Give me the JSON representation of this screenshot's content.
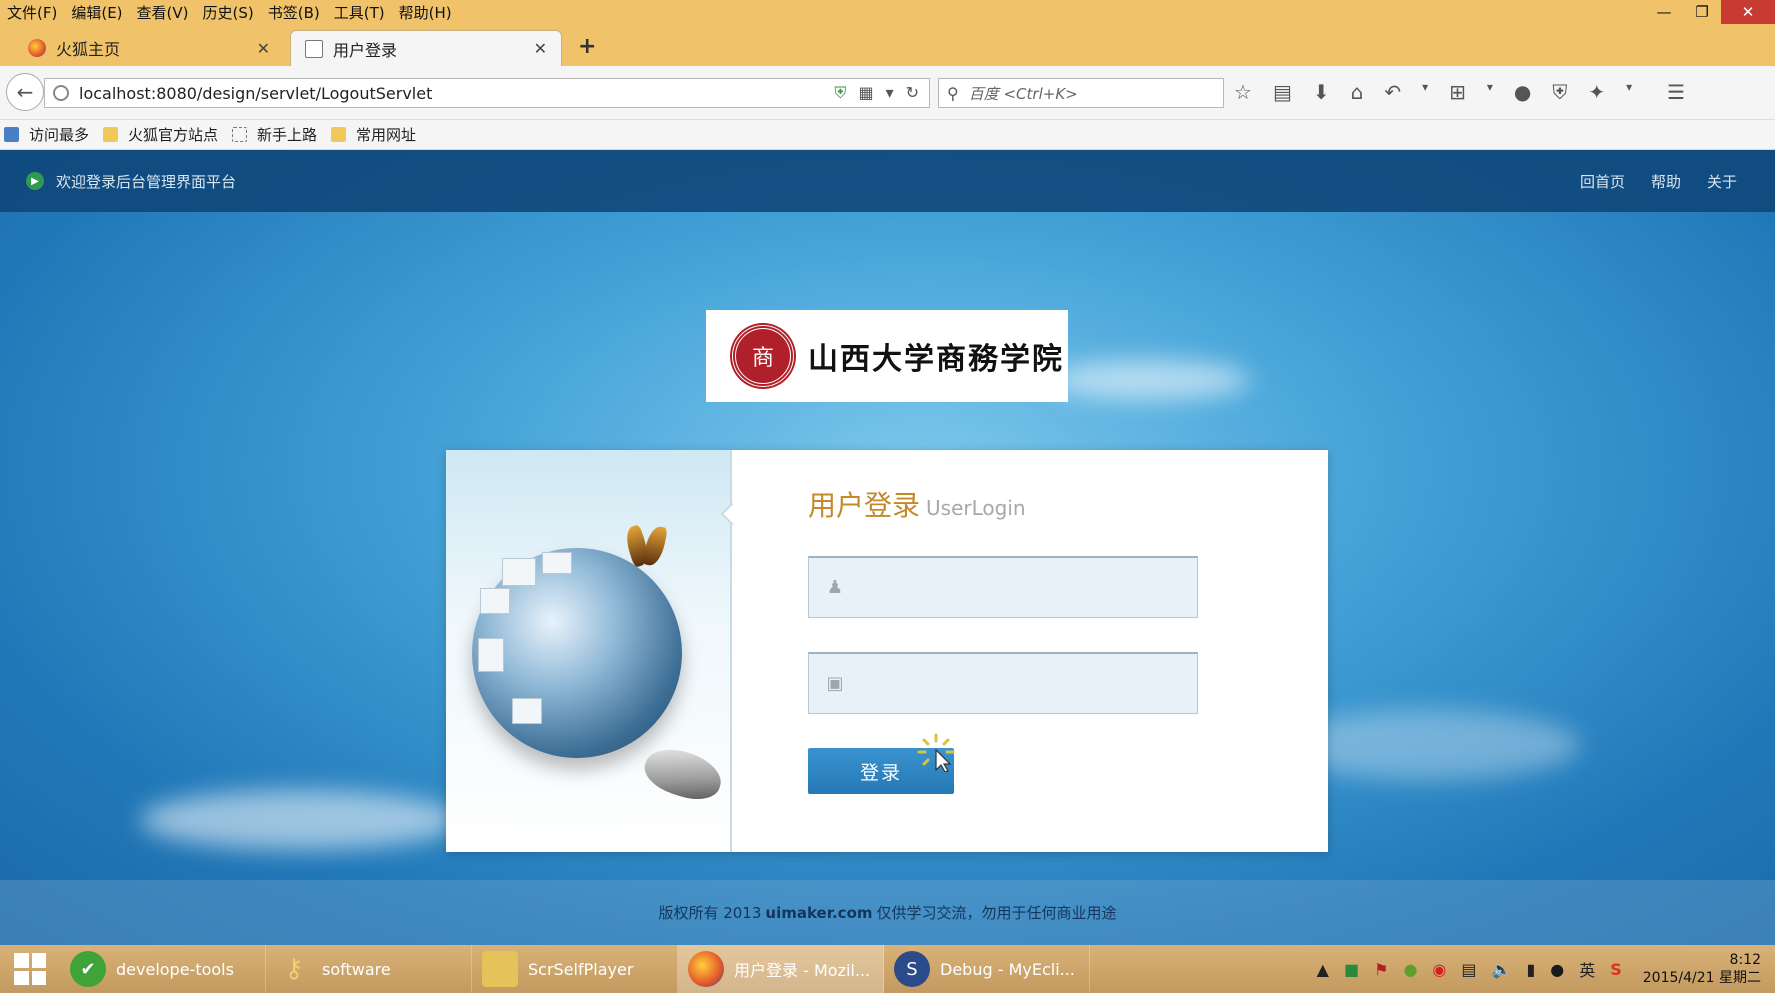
{
  "menubar": {
    "items": [
      "文件(F)",
      "编辑(E)",
      "查看(V)",
      "历史(S)",
      "书签(B)",
      "工具(T)",
      "帮助(H)"
    ]
  },
  "window": {
    "minimize": "—",
    "restore": "❐",
    "close": "✕"
  },
  "tabs": [
    {
      "title": "火狐主页",
      "close": "✕"
    },
    {
      "title": "用户登录",
      "close": "✕"
    }
  ],
  "newtab": "+",
  "nav": {
    "url": "localhost:8080/design/servlet/LogoutServlet",
    "search_placeholder": "百度 <Ctrl+K>"
  },
  "bookmarks": [
    "访问最多",
    "火狐官方站点",
    "新手上路",
    "常用网址"
  ],
  "page": {
    "welcome": "欢迎登录后台管理界面平台",
    "links": [
      "回首页",
      "帮助",
      "关于"
    ],
    "logo_name": "山西大学商務学院",
    "seal_glyph": "商",
    "login_title": "用户登录",
    "login_title_en": "UserLogin",
    "username_value": "",
    "password_value": "",
    "login_button": "登录",
    "footer_prefix": "版权所有 2013",
    "footer_site": "uimaker.com",
    "footer_suffix": "仅供学习交流，勿用于任何商业用途"
  },
  "taskbar": {
    "tasks": [
      {
        "label": "develope-tools",
        "color": "#3fa33a"
      },
      {
        "label": "software",
        "color": "#d9a23a"
      },
      {
        "label": "ScrSelfPlayer",
        "color": "#e6c25a"
      },
      {
        "label": "用户登录 - Mozil...",
        "color": "#e0622a"
      },
      {
        "label": "Debug - MyEcli...",
        "color": "#2b4a8a"
      }
    ],
    "time": "8:12",
    "date": "2015/4/21 星期二",
    "ime": "英"
  }
}
